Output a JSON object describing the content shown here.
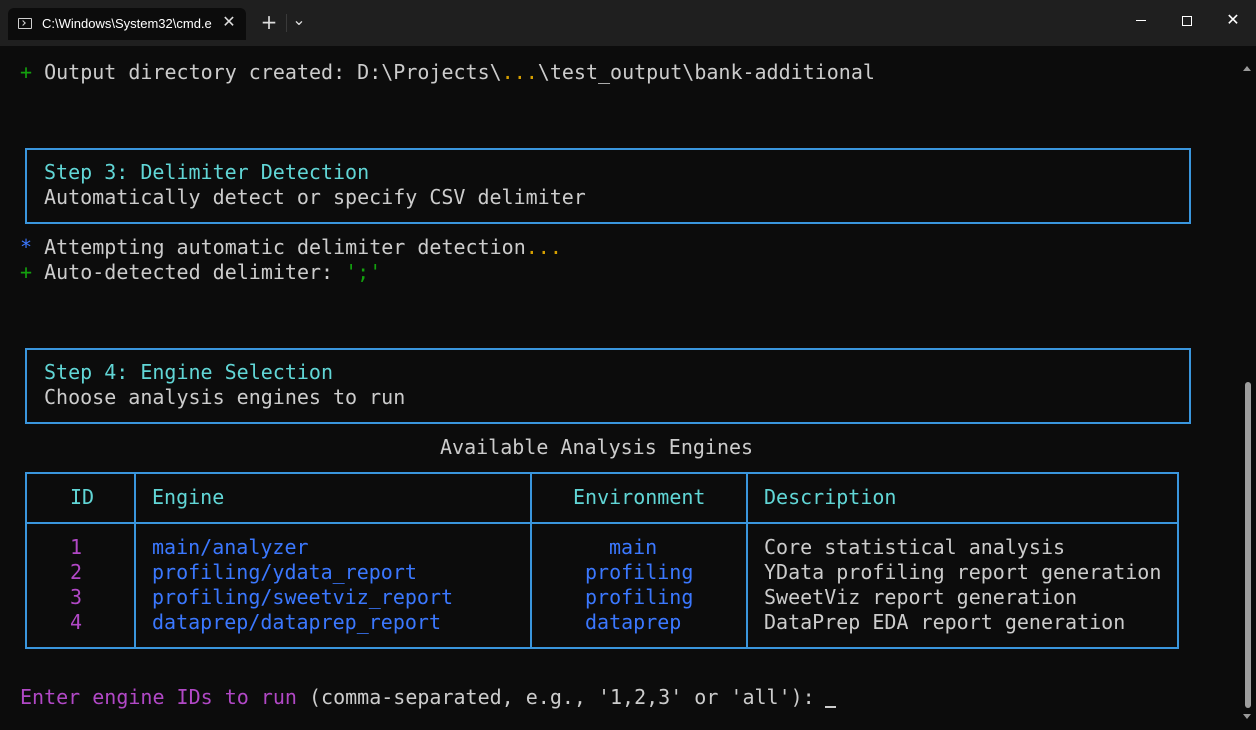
{
  "window": {
    "tab_title": "C:\\Windows\\System32\\cmd.e",
    "tab_close": "✕",
    "new_tab": "+",
    "dropdown": "⌄",
    "minimize": "minimize",
    "maximize": "maximize",
    "close": "✕"
  },
  "output": {
    "prefix": "+",
    "text": "Output directory created: D:\\Projects\\",
    "ellipsis": "...",
    "tail": "\\test_output\\bank-additional"
  },
  "step3": {
    "title": "Step 3: Delimiter Detection",
    "subtitle": "Automatically detect or specify CSV delimiter"
  },
  "detect": {
    "star": "*",
    "attempt": "Attempting automatic delimiter detection",
    "ellipsis": "...",
    "plus": "+",
    "detected_label": "Auto-detected delimiter: ",
    "delimiter": "';'"
  },
  "step4": {
    "title": "Step 4: Engine Selection",
    "subtitle": "Choose analysis engines to run"
  },
  "table": {
    "title": "Available Analysis Engines",
    "headers": [
      "ID",
      "Engine",
      "Environment",
      "Description"
    ],
    "rows": [
      {
        "id": "1",
        "engine": "main/analyzer",
        "env": "main",
        "desc": "Core statistical analysis"
      },
      {
        "id": "2",
        "engine": "profiling/ydata_report",
        "env": "profiling",
        "desc": "YData profiling report generation"
      },
      {
        "id": "3",
        "engine": "profiling/sweetviz_report",
        "env": "profiling",
        "desc": "SweetViz report generation"
      },
      {
        "id": "4",
        "engine": "dataprep/dataprep_report",
        "env": "dataprep",
        "desc": "DataPrep EDA report generation"
      }
    ]
  },
  "prompt": {
    "label": "Enter engine IDs to run",
    "hint": " (comma-separated, e.g., '1,2,3' or 'all'): "
  },
  "colors": {
    "background": "#0c0c0c",
    "border": "#3a96dd",
    "green": "#13a10e",
    "blue": "#3b78ff",
    "cyan": "#61d6d6",
    "magenta": "#b148c6"
  }
}
